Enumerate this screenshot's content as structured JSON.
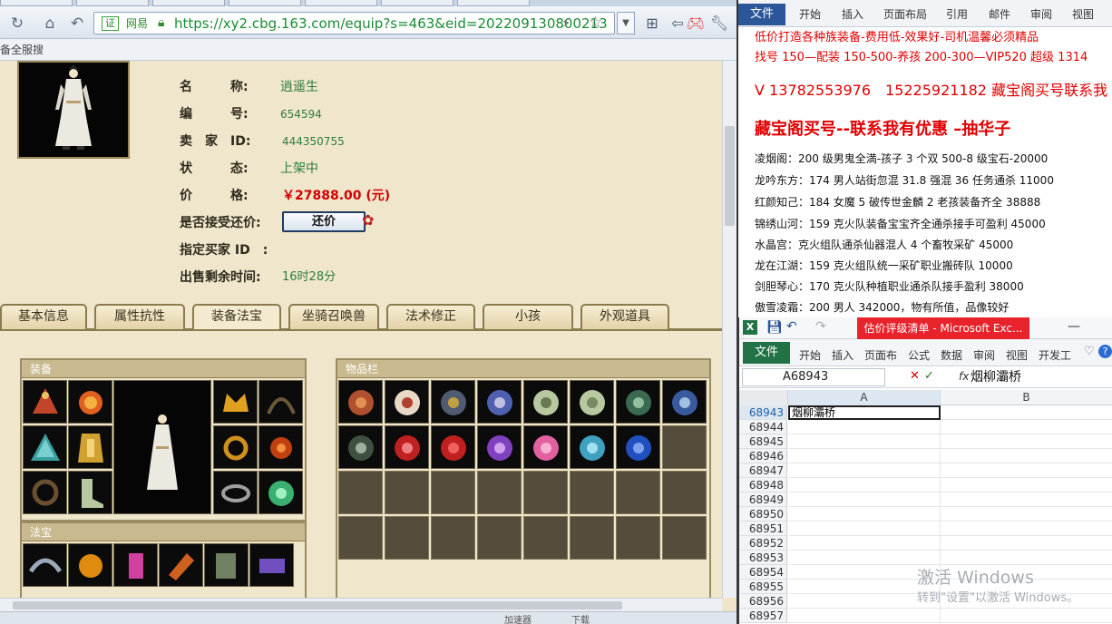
{
  "browser": {
    "url_cert": "证",
    "url_site": "网易",
    "url": "https://xy2.cbg.163.com/equip?s=463&eid=202209130800213",
    "bookmark": "备全服搜",
    "status_left": "加速器",
    "status_mid": "下载"
  },
  "item": {
    "rows": [
      {
        "label": "名　　　称:",
        "value": "逍遥生"
      },
      {
        "label": "编　　　号:",
        "value": "654594"
      },
      {
        "label": "卖　家　ID:",
        "value": "444350755"
      },
      {
        "label": "状　　　态:",
        "value": "上架中"
      },
      {
        "label": "价　　　格:",
        "value": "￥27888.00 (元)"
      },
      {
        "label": "是否接受还价:",
        "value": ""
      },
      {
        "label": "指定买家 ID　:",
        "value": ""
      },
      {
        "label": "出售剩余时间:",
        "value": "16时28分"
      }
    ],
    "counter_offer_label": "还价"
  },
  "tabs": [
    "基本信息",
    "属性抗性",
    "装备法宝",
    "坐骑召唤兽",
    "法术修正",
    "小孩",
    "外观道具"
  ],
  "panels": {
    "equipment_title": "装备",
    "treasure_title": "法宝",
    "inventory_title": "物品栏"
  },
  "word": {
    "file_label": "文件",
    "tabs": [
      "开始",
      "插入",
      "页面布局",
      "引用",
      "邮件",
      "审阅",
      "视图"
    ],
    "lines": [
      "低价打造各种族装备-费用低-效果好-司机温馨必须精品",
      "找号 150—配装 150-500-养孩 200-300—VIP520 超级 1314",
      "V 13782553976　15225921182 藏宝阁买号联系我",
      "藏宝阁买号--联系我有优惠 –抽华子",
      "凌烟阁：200 级男鬼全満-孩子 3 个双 500-8 级宝石-20000",
      "龙吟东方：174 男人站街忽混 31.8 强混 36 任务通杀 11000",
      "红颜知己：184 女魔 5 破传世金麟 2 老孩装备齐全 38888",
      "锦绣山河：159 克火队装备宝宝齐全通杀接手可盈利 45000",
      "水晶宫：克火组队通杀仙器混人 4 个畜牧采矿 45000",
      "龙在江湖：159 克火组队统一采矿职业搬砖队 10000",
      "剑胆琴心：170 克火队种植职业通杀队接手盈利 38000",
      "傲雪凌霜：200 男人 342000，物有所值，品像较好"
    ]
  },
  "excel": {
    "title": "估价评级清单 - Microsoft Exc...",
    "file_label": "文件",
    "tabs": [
      "开始",
      "插入",
      "页面布",
      "公式",
      "数据",
      "审阅",
      "视图",
      "开发工"
    ],
    "namebox": "A68943",
    "fx": "fx",
    "formula_value": "烟柳灞桥",
    "columns": [
      "A",
      "B"
    ],
    "rows": [
      "68943",
      "68944",
      "68945",
      "68946",
      "68947",
      "68948",
      "68949",
      "68950",
      "68951",
      "68952",
      "68953",
      "68954",
      "68955",
      "68956",
      "68957"
    ],
    "active_cell_value": "烟柳灞桥",
    "watermark_title": "激活 Windows",
    "watermark_sub": "转到\"设置\"以激活 Windows。"
  }
}
